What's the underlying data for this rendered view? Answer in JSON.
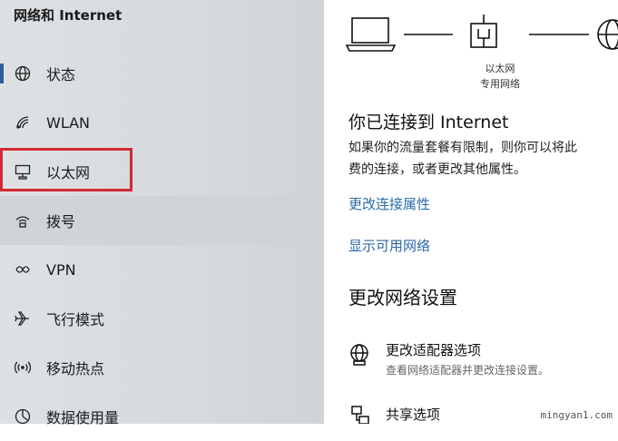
{
  "sidebar": {
    "title": "网络和 Internet",
    "items": [
      {
        "label": "状态",
        "icon": "globe-icon"
      },
      {
        "label": "WLAN",
        "icon": "wifi-icon"
      },
      {
        "label": "以太网",
        "icon": "ethernet-icon"
      },
      {
        "label": "拨号",
        "icon": "dialup-icon"
      },
      {
        "label": "VPN",
        "icon": "vpn-icon"
      },
      {
        "label": "飞行模式",
        "icon": "airplane-icon"
      },
      {
        "label": "移动热点",
        "icon": "hotspot-icon"
      },
      {
        "label": "数据使用量",
        "icon": "data-usage-icon"
      }
    ]
  },
  "main": {
    "diagram": {
      "caption_line1": "以太网",
      "caption_line2": "专用网络"
    },
    "status_heading": "你已连接到 Internet",
    "status_desc_line1": "如果你的流量套餐有限制，则你可以将此",
    "status_desc_line2": "费的连接，或者更改其他属性。",
    "link_change_properties": "更改连接属性",
    "link_show_networks": "显示可用网络",
    "section_heading": "更改网络设置",
    "options": [
      {
        "title": "更改适配器选项",
        "subtitle": "查看网络适配器并更改连接设置。",
        "icon": "adapter-globe-icon"
      },
      {
        "title": "共享选项",
        "icon": "sharing-icon"
      }
    ]
  },
  "watermark": "mingyan1.com",
  "colors": {
    "accent": "#2b6aa8",
    "highlight_box": "#d42a35",
    "active_indicator": "#2f5f9a"
  }
}
